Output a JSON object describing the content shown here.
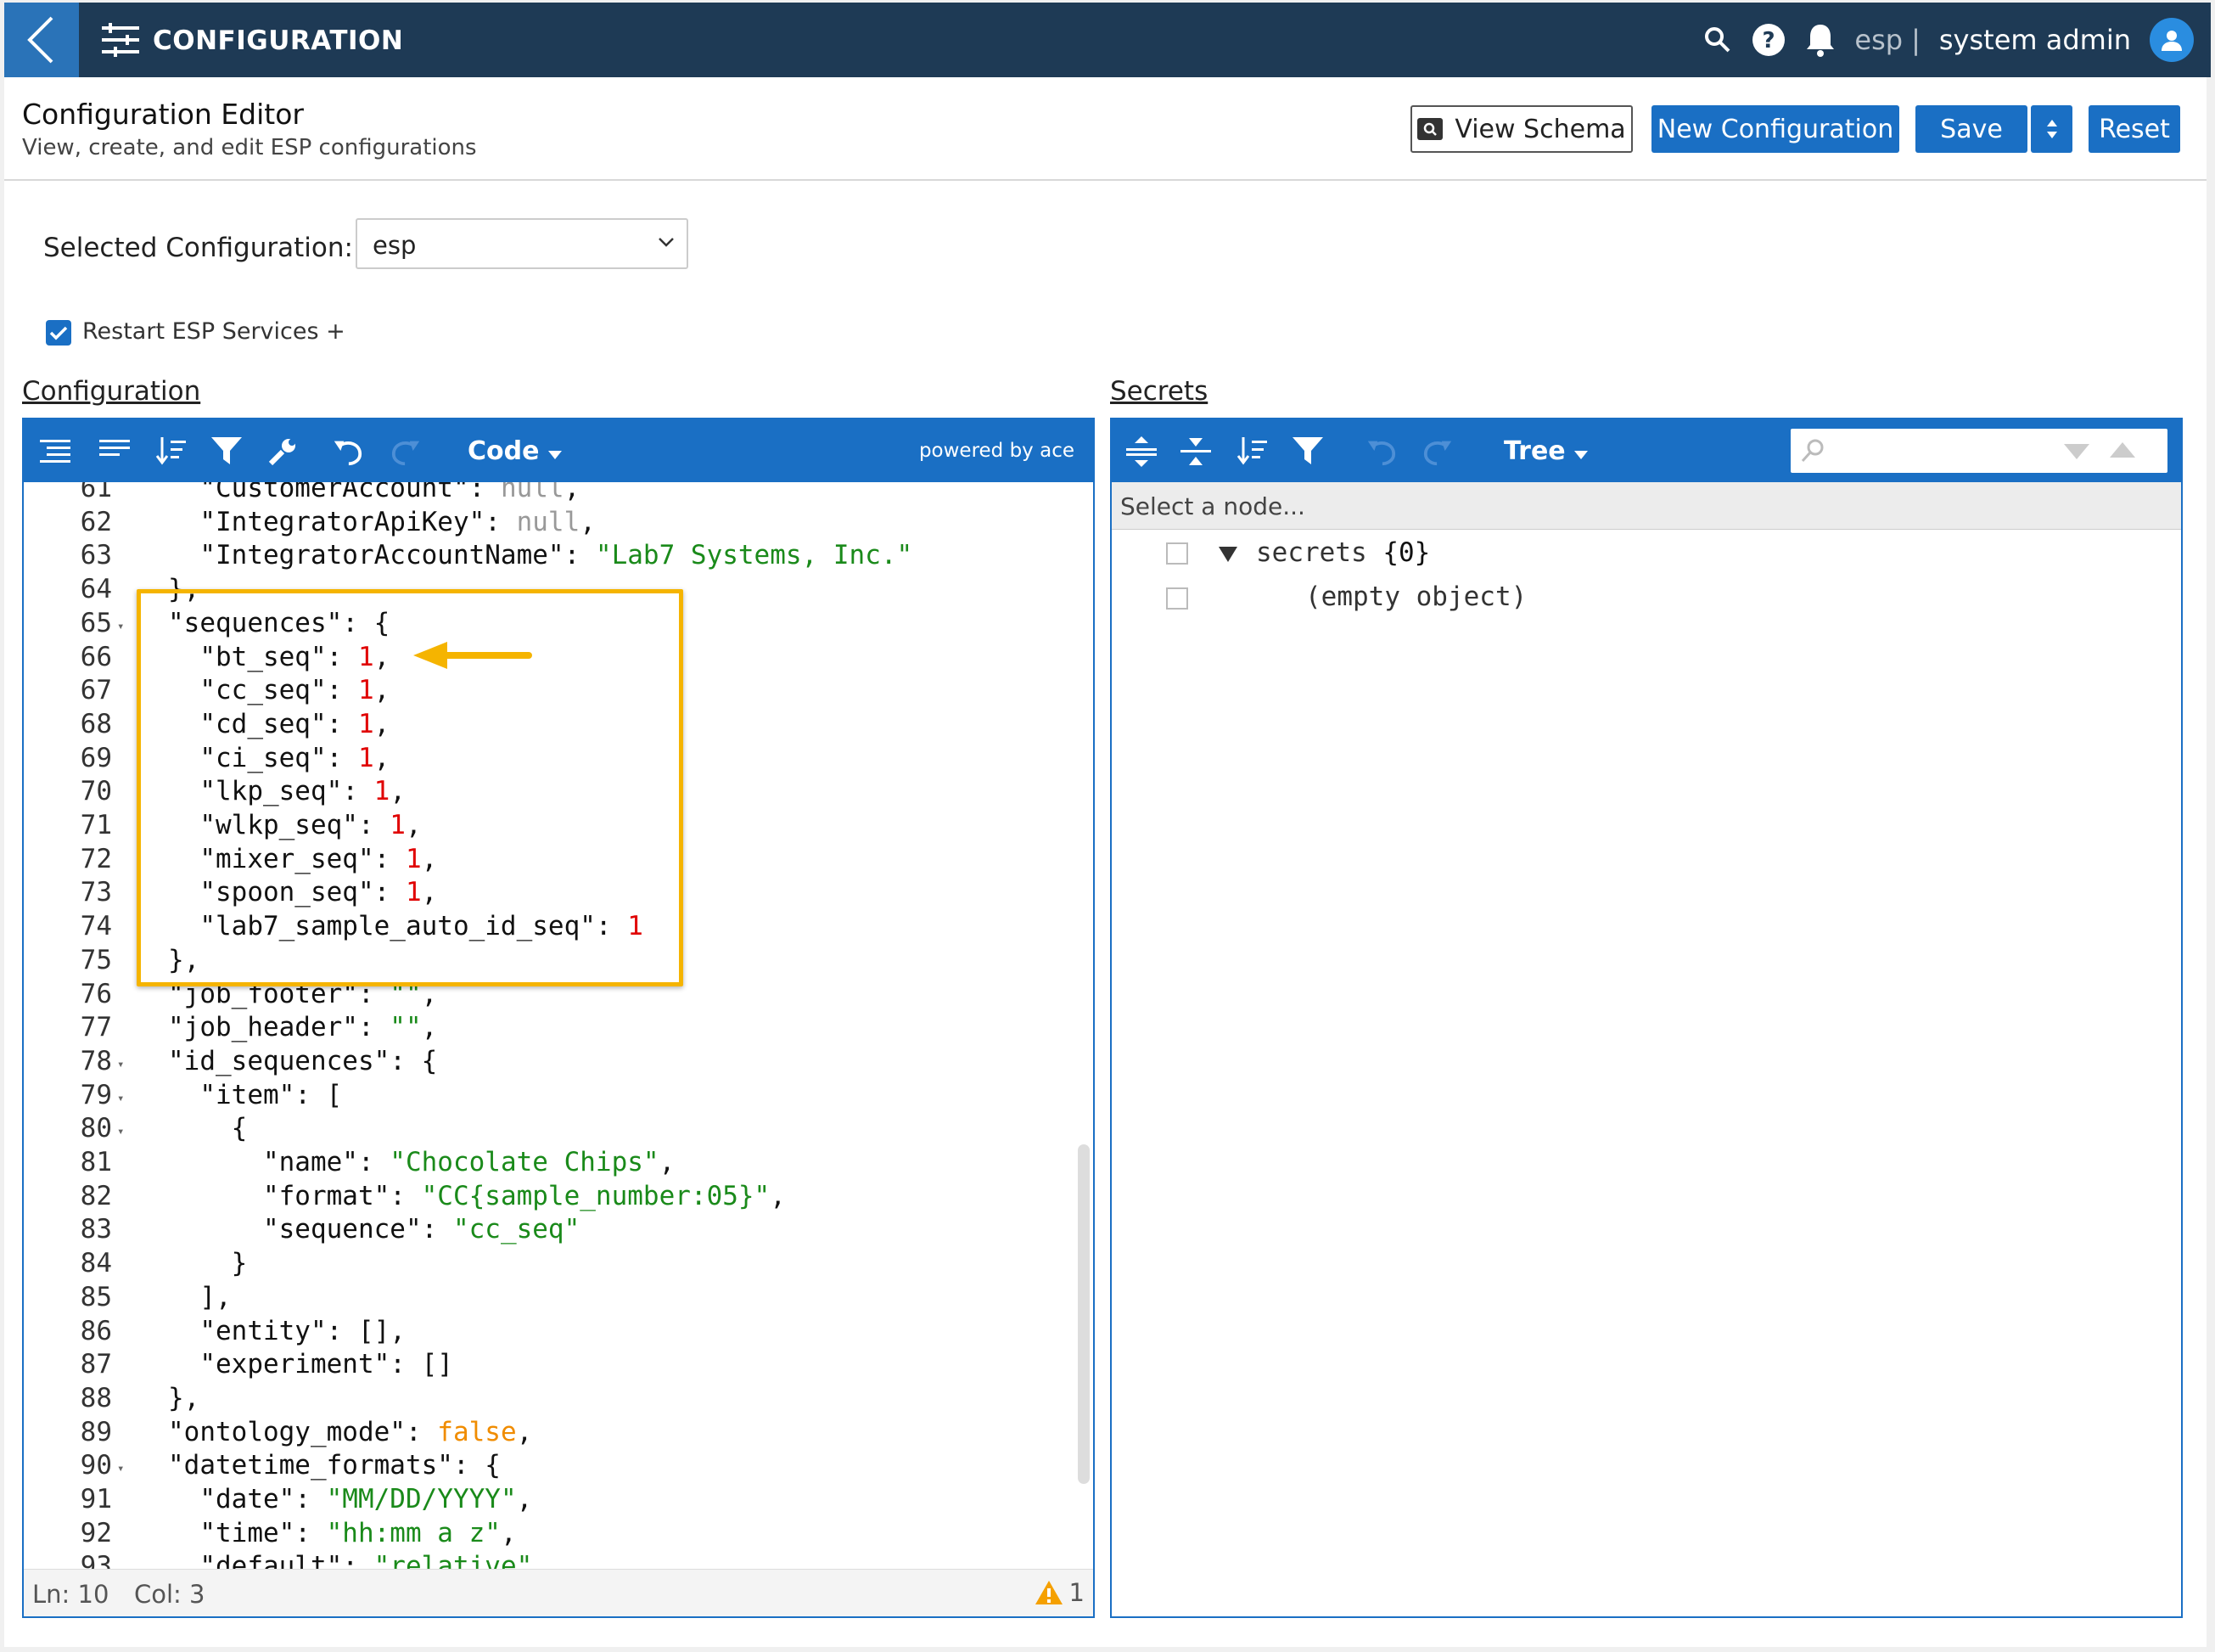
{
  "navbar": {
    "title": "CONFIGURATION",
    "tenant": "esp",
    "separator": "|",
    "user": "system admin"
  },
  "header": {
    "title": "Configuration Editor",
    "subtitle": "View, create, and edit ESP configurations",
    "view_schema": "View Schema",
    "new_config": "New Configuration",
    "save": "Save",
    "reset": "Reset"
  },
  "form": {
    "selected_label": "Selected Configuration:",
    "selected_value": "esp",
    "restart_label": "Restart ESP Services +",
    "restart_checked": true
  },
  "config_editor": {
    "section_label": "Configuration",
    "mode": "Code",
    "powered_by": "powered by ace",
    "status_ln": "Ln: 10",
    "status_col": "Col: 3",
    "warnings": "1"
  },
  "code_lines": [
    {
      "n": "61",
      "fold": false,
      "html": "  <span class=\"k\">\"CustomerAccount\"</span><span class=\"p\">: </span><span class=\"nl\">null</span><span class=\"p\">,</span>"
    },
    {
      "n": "62",
      "fold": false,
      "html": "  <span class=\"k\">\"IntegratorApiKey\"</span><span class=\"p\">: </span><span class=\"nl\">null</span><span class=\"p\">,</span>"
    },
    {
      "n": "63",
      "fold": false,
      "html": "  <span class=\"k\">\"IntegratorAccountName\"</span><span class=\"p\">: </span><span class=\"s\">\"Lab7 Systems, Inc.\"</span>"
    },
    {
      "n": "64",
      "fold": false,
      "html": "<span class=\"p\">},</span>"
    },
    {
      "n": "65",
      "fold": true,
      "html": "<span class=\"k\">\"sequences\"</span><span class=\"p\">: {</span>"
    },
    {
      "n": "66",
      "fold": false,
      "html": "  <span class=\"k\">\"bt_seq\"</span><span class=\"p\">: </span><span class=\"n\">1</span><span class=\"p\">,</span>"
    },
    {
      "n": "67",
      "fold": false,
      "html": "  <span class=\"k\">\"cc_seq\"</span><span class=\"p\">: </span><span class=\"n\">1</span><span class=\"p\">,</span>"
    },
    {
      "n": "68",
      "fold": false,
      "html": "  <span class=\"k\">\"cd_seq\"</span><span class=\"p\">: </span><span class=\"n\">1</span><span class=\"p\">,</span>"
    },
    {
      "n": "69",
      "fold": false,
      "html": "  <span class=\"k\">\"ci_seq\"</span><span class=\"p\">: </span><span class=\"n\">1</span><span class=\"p\">,</span>"
    },
    {
      "n": "70",
      "fold": false,
      "html": "  <span class=\"k\">\"lkp_seq\"</span><span class=\"p\">: </span><span class=\"n\">1</span><span class=\"p\">,</span>"
    },
    {
      "n": "71",
      "fold": false,
      "html": "  <span class=\"k\">\"wlkp_seq\"</span><span class=\"p\">: </span><span class=\"n\">1</span><span class=\"p\">,</span>"
    },
    {
      "n": "72",
      "fold": false,
      "html": "  <span class=\"k\">\"mixer_seq\"</span><span class=\"p\">: </span><span class=\"n\">1</span><span class=\"p\">,</span>"
    },
    {
      "n": "73",
      "fold": false,
      "html": "  <span class=\"k\">\"spoon_seq\"</span><span class=\"p\">: </span><span class=\"n\">1</span><span class=\"p\">,</span>"
    },
    {
      "n": "74",
      "fold": false,
      "html": "  <span class=\"k\">\"lab7_sample_auto_id_seq\"</span><span class=\"p\">: </span><span class=\"n\">1</span>"
    },
    {
      "n": "75",
      "fold": false,
      "html": "<span class=\"p\">},</span>"
    },
    {
      "n": "76",
      "fold": false,
      "html": "<span class=\"k\">\"job_footer\"</span><span class=\"p\">: </span><span class=\"s\">\"\"</span><span class=\"p\">,</span>"
    },
    {
      "n": "77",
      "fold": false,
      "html": "<span class=\"k\">\"job_header\"</span><span class=\"p\">: </span><span class=\"s\">\"\"</span><span class=\"p\">,</span>"
    },
    {
      "n": "78",
      "fold": true,
      "html": "<span class=\"k\">\"id_sequences\"</span><span class=\"p\">: {</span>"
    },
    {
      "n": "79",
      "fold": true,
      "html": "  <span class=\"k\">\"item\"</span><span class=\"p\">: [</span>"
    },
    {
      "n": "80",
      "fold": true,
      "html": "    <span class=\"p\">{</span>"
    },
    {
      "n": "81",
      "fold": false,
      "html": "      <span class=\"k\">\"name\"</span><span class=\"p\">: </span><span class=\"s\">\"Chocolate Chips\"</span><span class=\"p\">,</span>"
    },
    {
      "n": "82",
      "fold": false,
      "html": "      <span class=\"k\">\"format\"</span><span class=\"p\">: </span><span class=\"s\">\"CC{sample_number:05}\"</span><span class=\"p\">,</span>"
    },
    {
      "n": "83",
      "fold": false,
      "html": "      <span class=\"k\">\"sequence\"</span><span class=\"p\">: </span><span class=\"s\">\"cc_seq\"</span>"
    },
    {
      "n": "84",
      "fold": false,
      "html": "    <span class=\"p\">}</span>"
    },
    {
      "n": "85",
      "fold": false,
      "html": "  <span class=\"p\">],</span>"
    },
    {
      "n": "86",
      "fold": false,
      "html": "  <span class=\"k\">\"entity\"</span><span class=\"p\">: [],</span>"
    },
    {
      "n": "87",
      "fold": false,
      "html": "  <span class=\"k\">\"experiment\"</span><span class=\"p\">: []</span>"
    },
    {
      "n": "88",
      "fold": false,
      "html": "<span class=\"p\">},</span>"
    },
    {
      "n": "89",
      "fold": false,
      "html": "<span class=\"k\">\"ontology_mode\"</span><span class=\"p\">: </span><span class=\"b\">false</span><span class=\"p\">,</span>"
    },
    {
      "n": "90",
      "fold": true,
      "html": "<span class=\"k\">\"datetime_formats\"</span><span class=\"p\">: {</span>"
    },
    {
      "n": "91",
      "fold": false,
      "html": "  <span class=\"k\">\"date\"</span><span class=\"p\">: </span><span class=\"s\">\"MM/DD/YYYY\"</span><span class=\"p\">,</span>"
    },
    {
      "n": "92",
      "fold": false,
      "html": "  <span class=\"k\">\"time\"</span><span class=\"p\">: </span><span class=\"s\">\"hh:mm a z\"</span><span class=\"p\">,</span>"
    },
    {
      "n": "93",
      "fold": false,
      "html": "  <span class=\"k\">\"default\"</span><span class=\"p\">: </span><span class=\"s\">\"relative\"</span>"
    }
  ],
  "secrets_editor": {
    "section_label": "Secrets",
    "mode": "Tree",
    "select_node": "Select a node...",
    "root_key": "secrets",
    "root_count": "{0}",
    "empty_label": "(empty object)"
  },
  "colors": {
    "navbar": "#1e3a55",
    "accent": "#1a6fc4",
    "highlight": "#f5b400",
    "number": "#e00000",
    "string": "#1a8a1a",
    "boolean": "#f08c00"
  }
}
